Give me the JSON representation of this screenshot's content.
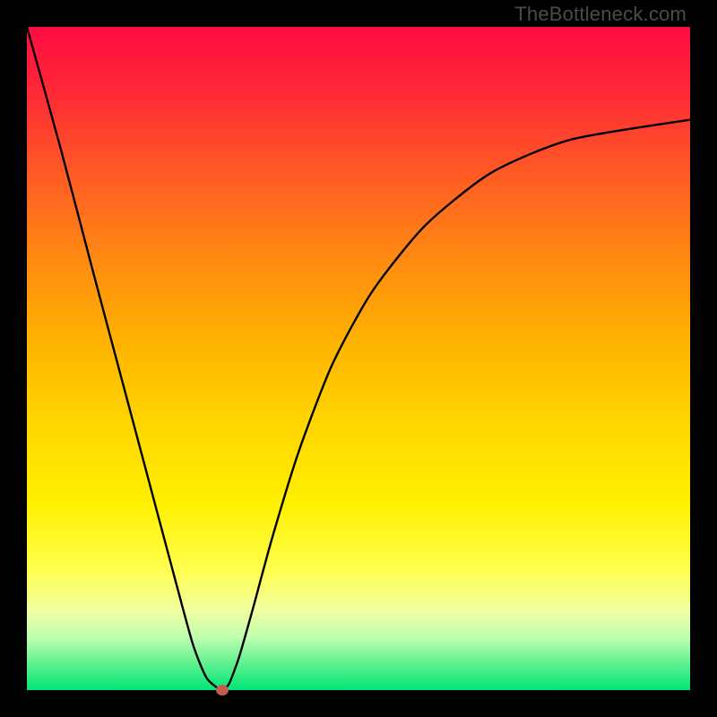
{
  "watermark": "TheBottleneck.com",
  "colors": {
    "frame": "#000000",
    "curve": "#000000",
    "marker": "#c95a4f"
  },
  "chart_data": {
    "type": "line",
    "title": "",
    "xlabel": "",
    "ylabel": "",
    "xlim": [
      0,
      100
    ],
    "ylim": [
      0,
      100
    ],
    "grid": false,
    "series": [
      {
        "name": "bottleneck-curve",
        "x": [
          0,
          5,
          10,
          14,
          18,
          22,
          25,
          27,
          28.5,
          29.5,
          30.5,
          32,
          34,
          37,
          41,
          46,
          52,
          60,
          70,
          82,
          100
        ],
        "y": [
          100,
          82,
          63,
          48,
          33,
          18,
          7,
          2,
          0.5,
          0,
          1,
          5,
          12,
          23,
          36,
          49,
          60,
          70,
          78,
          83,
          86
        ]
      }
    ],
    "annotations": [
      {
        "name": "minimum-marker",
        "x": 29.5,
        "y": 0
      }
    ],
    "background_gradient": "red-to-green-vertical"
  }
}
